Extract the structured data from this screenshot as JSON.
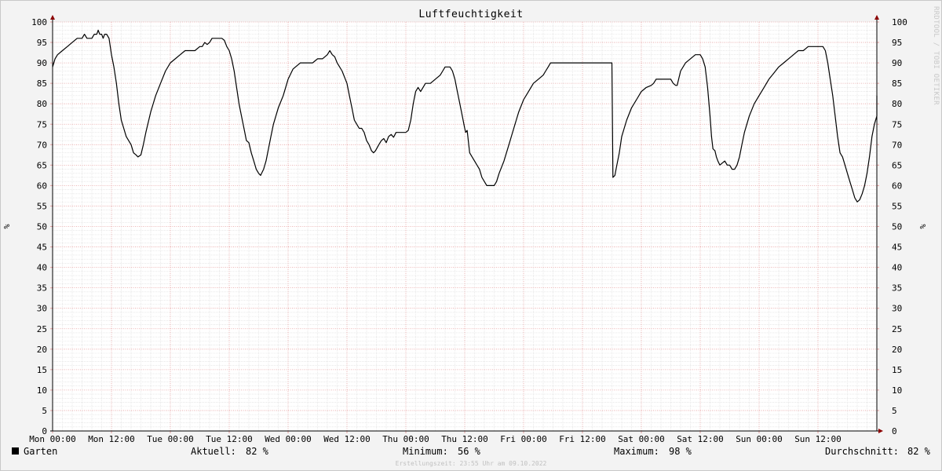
{
  "chart_data": {
    "type": "line",
    "title": "Luftfeuchtigkeit",
    "ylabel": "%",
    "ylabel_right": "%",
    "ylim": [
      0,
      100
    ],
    "y_ticks": [
      0,
      5,
      10,
      15,
      20,
      25,
      30,
      35,
      40,
      45,
      50,
      55,
      60,
      65,
      70,
      75,
      80,
      85,
      90,
      95,
      100
    ],
    "xlim": [
      0,
      168
    ],
    "x_tick_hours": [
      0,
      12,
      24,
      36,
      48,
      60,
      72,
      84,
      96,
      108,
      120,
      132,
      144,
      156
    ],
    "x_tick_labels": [
      "Mon 00:00",
      "Mon 12:00",
      "Tue 00:00",
      "Tue 12:00",
      "Wed 00:00",
      "Wed 12:00",
      "Thu 00:00",
      "Thu 12:00",
      "Fri 00:00",
      "Fri 12:00",
      "Sat 00:00",
      "Sat 12:00",
      "Sun 00:00",
      "Sun 12:00"
    ],
    "grid": true,
    "series": [
      {
        "name": "Garten",
        "color": "#000000",
        "points": [
          [
            0,
            89
          ],
          [
            0.5,
            91
          ],
          [
            1,
            92
          ],
          [
            2,
            93
          ],
          [
            3,
            94
          ],
          [
            4,
            95
          ],
          [
            5,
            96
          ],
          [
            6,
            96
          ],
          [
            6.5,
            97
          ],
          [
            7,
            96
          ],
          [
            8,
            96
          ],
          [
            8.5,
            97
          ],
          [
            9,
            97
          ],
          [
            9.3,
            98
          ],
          [
            9.6,
            97
          ],
          [
            10,
            97
          ],
          [
            10.3,
            96
          ],
          [
            10.6,
            97
          ],
          [
            11,
            97
          ],
          [
            11.5,
            96
          ],
          [
            12,
            92
          ],
          [
            12.5,
            89
          ],
          [
            13,
            85
          ],
          [
            13.5,
            80
          ],
          [
            14,
            76
          ],
          [
            15,
            72
          ],
          [
            16,
            70
          ],
          [
            16.5,
            68
          ],
          [
            17,
            67.5
          ],
          [
            17.4,
            67
          ],
          [
            18,
            67.5
          ],
          [
            18.5,
            70
          ],
          [
            19,
            73
          ],
          [
            20,
            78
          ],
          [
            21,
            82
          ],
          [
            22,
            85
          ],
          [
            23,
            88
          ],
          [
            24,
            90
          ],
          [
            25,
            91
          ],
          [
            26,
            92
          ],
          [
            27,
            93
          ],
          [
            28,
            93
          ],
          [
            29,
            93
          ],
          [
            30,
            94
          ],
          [
            30.5,
            94
          ],
          [
            31,
            95
          ],
          [
            31.5,
            94.5
          ],
          [
            32,
            95
          ],
          [
            32.5,
            96
          ],
          [
            33,
            96
          ],
          [
            34,
            96
          ],
          [
            34.5,
            96
          ],
          [
            35,
            95.5
          ],
          [
            35.5,
            94
          ],
          [
            36,
            93
          ],
          [
            36.5,
            91
          ],
          [
            37,
            88
          ],
          [
            37.5,
            84
          ],
          [
            38,
            80
          ],
          [
            38.5,
            77
          ],
          [
            39,
            74
          ],
          [
            39.5,
            71
          ],
          [
            40,
            70.5
          ],
          [
            40.5,
            68
          ],
          [
            41,
            66
          ],
          [
            41.5,
            64
          ],
          [
            42,
            63
          ],
          [
            42.4,
            62.5
          ],
          [
            43,
            64
          ],
          [
            43.5,
            66
          ],
          [
            44,
            69
          ],
          [
            44.5,
            72
          ],
          [
            45,
            75
          ],
          [
            46,
            79
          ],
          [
            47,
            82
          ],
          [
            48,
            86
          ],
          [
            49,
            88.5
          ],
          [
            50,
            89.5
          ],
          [
            50.5,
            90
          ],
          [
            52,
            90
          ],
          [
            53,
            90
          ],
          [
            53.5,
            90.5
          ],
          [
            54,
            91
          ],
          [
            55,
            91
          ],
          [
            55.5,
            91.5
          ],
          [
            56,
            92
          ],
          [
            56.5,
            93
          ],
          [
            57,
            92
          ],
          [
            57.5,
            91.5
          ],
          [
            58,
            90
          ],
          [
            59,
            88
          ],
          [
            60,
            85
          ],
          [
            60.5,
            82
          ],
          [
            61,
            79
          ],
          [
            61.5,
            76
          ],
          [
            62,
            75
          ],
          [
            62.5,
            74
          ],
          [
            63,
            74
          ],
          [
            63.5,
            73
          ],
          [
            64,
            71
          ],
          [
            64.5,
            70
          ],
          [
            65,
            68.5
          ],
          [
            65.4,
            68
          ],
          [
            65.8,
            68.5
          ],
          [
            66.5,
            70
          ],
          [
            67,
            71
          ],
          [
            67.5,
            71.5
          ],
          [
            68,
            70.5
          ],
          [
            68.5,
            72
          ],
          [
            69,
            72.5
          ],
          [
            69.5,
            71.8
          ],
          [
            70,
            73
          ],
          [
            71,
            73
          ],
          [
            72,
            73
          ],
          [
            72.5,
            73.5
          ],
          [
            73,
            76
          ],
          [
            73.5,
            80
          ],
          [
            74,
            83
          ],
          [
            74.5,
            84
          ],
          [
            75,
            83
          ],
          [
            75.5,
            84
          ],
          [
            76,
            85
          ],
          [
            77,
            85
          ],
          [
            78,
            86
          ],
          [
            79,
            87
          ],
          [
            79.5,
            88
          ],
          [
            80,
            89
          ],
          [
            81,
            89
          ],
          [
            81.5,
            88
          ],
          [
            82,
            86
          ],
          [
            82.5,
            83
          ],
          [
            83,
            80
          ],
          [
            83.5,
            77
          ],
          [
            84,
            74
          ],
          [
            84.2,
            73
          ],
          [
            84.5,
            73.5
          ],
          [
            85,
            68
          ],
          [
            86,
            66
          ],
          [
            86.5,
            65
          ],
          [
            87,
            64
          ],
          [
            87.5,
            62
          ],
          [
            88,
            61
          ],
          [
            88.5,
            60
          ],
          [
            89,
            60
          ],
          [
            89.5,
            60
          ],
          [
            90,
            60
          ],
          [
            90.5,
            61
          ],
          [
            91,
            63
          ],
          [
            92,
            66
          ],
          [
            93,
            70
          ],
          [
            94,
            74
          ],
          [
            95,
            78
          ],
          [
            96,
            81
          ],
          [
            97,
            83
          ],
          [
            98,
            85
          ],
          [
            99,
            86
          ],
          [
            100,
            87
          ],
          [
            100.5,
            88
          ],
          [
            101,
            89
          ],
          [
            101.5,
            90
          ],
          [
            102,
            90
          ],
          [
            108,
            90
          ],
          [
            114,
            90
          ],
          [
            114.2,
            62
          ],
          [
            114.6,
            62.5
          ],
          [
            115,
            65
          ],
          [
            115.5,
            68
          ],
          [
            116,
            72
          ],
          [
            117,
            76
          ],
          [
            118,
            79
          ],
          [
            119,
            81
          ],
          [
            120,
            83
          ],
          [
            121,
            84
          ],
          [
            122,
            84.5
          ],
          [
            122.5,
            85
          ],
          [
            123,
            86
          ],
          [
            124,
            86
          ],
          [
            125,
            86
          ],
          [
            126,
            86
          ],
          [
            126.5,
            85
          ],
          [
            127,
            84.5
          ],
          [
            127.3,
            84.5
          ],
          [
            127.6,
            86
          ],
          [
            128,
            88
          ],
          [
            129,
            90
          ],
          [
            130,
            91
          ],
          [
            131,
            92
          ],
          [
            132,
            92
          ],
          [
            132.5,
            91
          ],
          [
            133,
            89
          ],
          [
            133.5,
            84
          ],
          [
            134,
            77
          ],
          [
            134.3,
            72
          ],
          [
            134.6,
            69
          ],
          [
            135,
            68.5
          ],
          [
            135.3,
            67
          ],
          [
            135.6,
            66
          ],
          [
            136,
            65
          ],
          [
            136.5,
            65.5
          ],
          [
            137,
            66
          ],
          [
            137.5,
            65
          ],
          [
            138,
            65
          ],
          [
            138.5,
            64
          ],
          [
            139,
            64
          ],
          [
            139.5,
            65
          ],
          [
            140,
            67
          ],
          [
            140.5,
            70
          ],
          [
            141,
            73
          ],
          [
            142,
            77
          ],
          [
            143,
            80
          ],
          [
            144,
            82
          ],
          [
            145,
            84
          ],
          [
            146,
            86
          ],
          [
            147,
            87.5
          ],
          [
            148,
            89
          ],
          [
            149,
            90
          ],
          [
            150,
            91
          ],
          [
            151,
            92
          ],
          [
            152,
            93
          ],
          [
            153,
            93
          ],
          [
            153.5,
            93.5
          ],
          [
            154,
            94
          ],
          [
            155,
            94
          ],
          [
            156,
            94
          ],
          [
            157,
            94
          ],
          [
            157.5,
            93
          ],
          [
            158,
            90
          ],
          [
            158.5,
            86
          ],
          [
            159,
            82
          ],
          [
            159.5,
            77
          ],
          [
            160,
            72
          ],
          [
            160.5,
            68
          ],
          [
            161,
            67
          ],
          [
            161.5,
            65
          ],
          [
            162,
            63
          ],
          [
            162.5,
            61
          ],
          [
            163,
            59
          ],
          [
            163.5,
            57
          ],
          [
            164,
            56
          ],
          [
            164.5,
            56.5
          ],
          [
            165,
            58
          ],
          [
            165.5,
            60
          ],
          [
            166,
            63
          ],
          [
            166.5,
            67
          ],
          [
            167,
            72
          ],
          [
            167.5,
            75
          ],
          [
            168,
            77
          ],
          [
            168.5,
            80
          ],
          [
            169,
            82
          ]
        ]
      }
    ],
    "legend": {
      "series_label": "Garten",
      "current_label": "Aktuell:",
      "current_value": "82 %",
      "min_label": "Minimum:",
      "min_value": "56 %",
      "max_label": "Maximum:",
      "max_value": "98 %",
      "avg_label": "Durchschnitt:",
      "avg_value": "82 %"
    },
    "watermark": "RRDTOOL / TOBI OETIKER",
    "footer": "Erstellungszeit: 23:55 Uhr am 09.10.2022",
    "colors": {
      "canvas": "#ffffff",
      "background": "#f3f3f3",
      "minor_grid": "#dcdcdc",
      "major_grid": "#e6a0a0",
      "axis": "#000000",
      "arrow": "#8b0000",
      "line": "#000000"
    }
  }
}
